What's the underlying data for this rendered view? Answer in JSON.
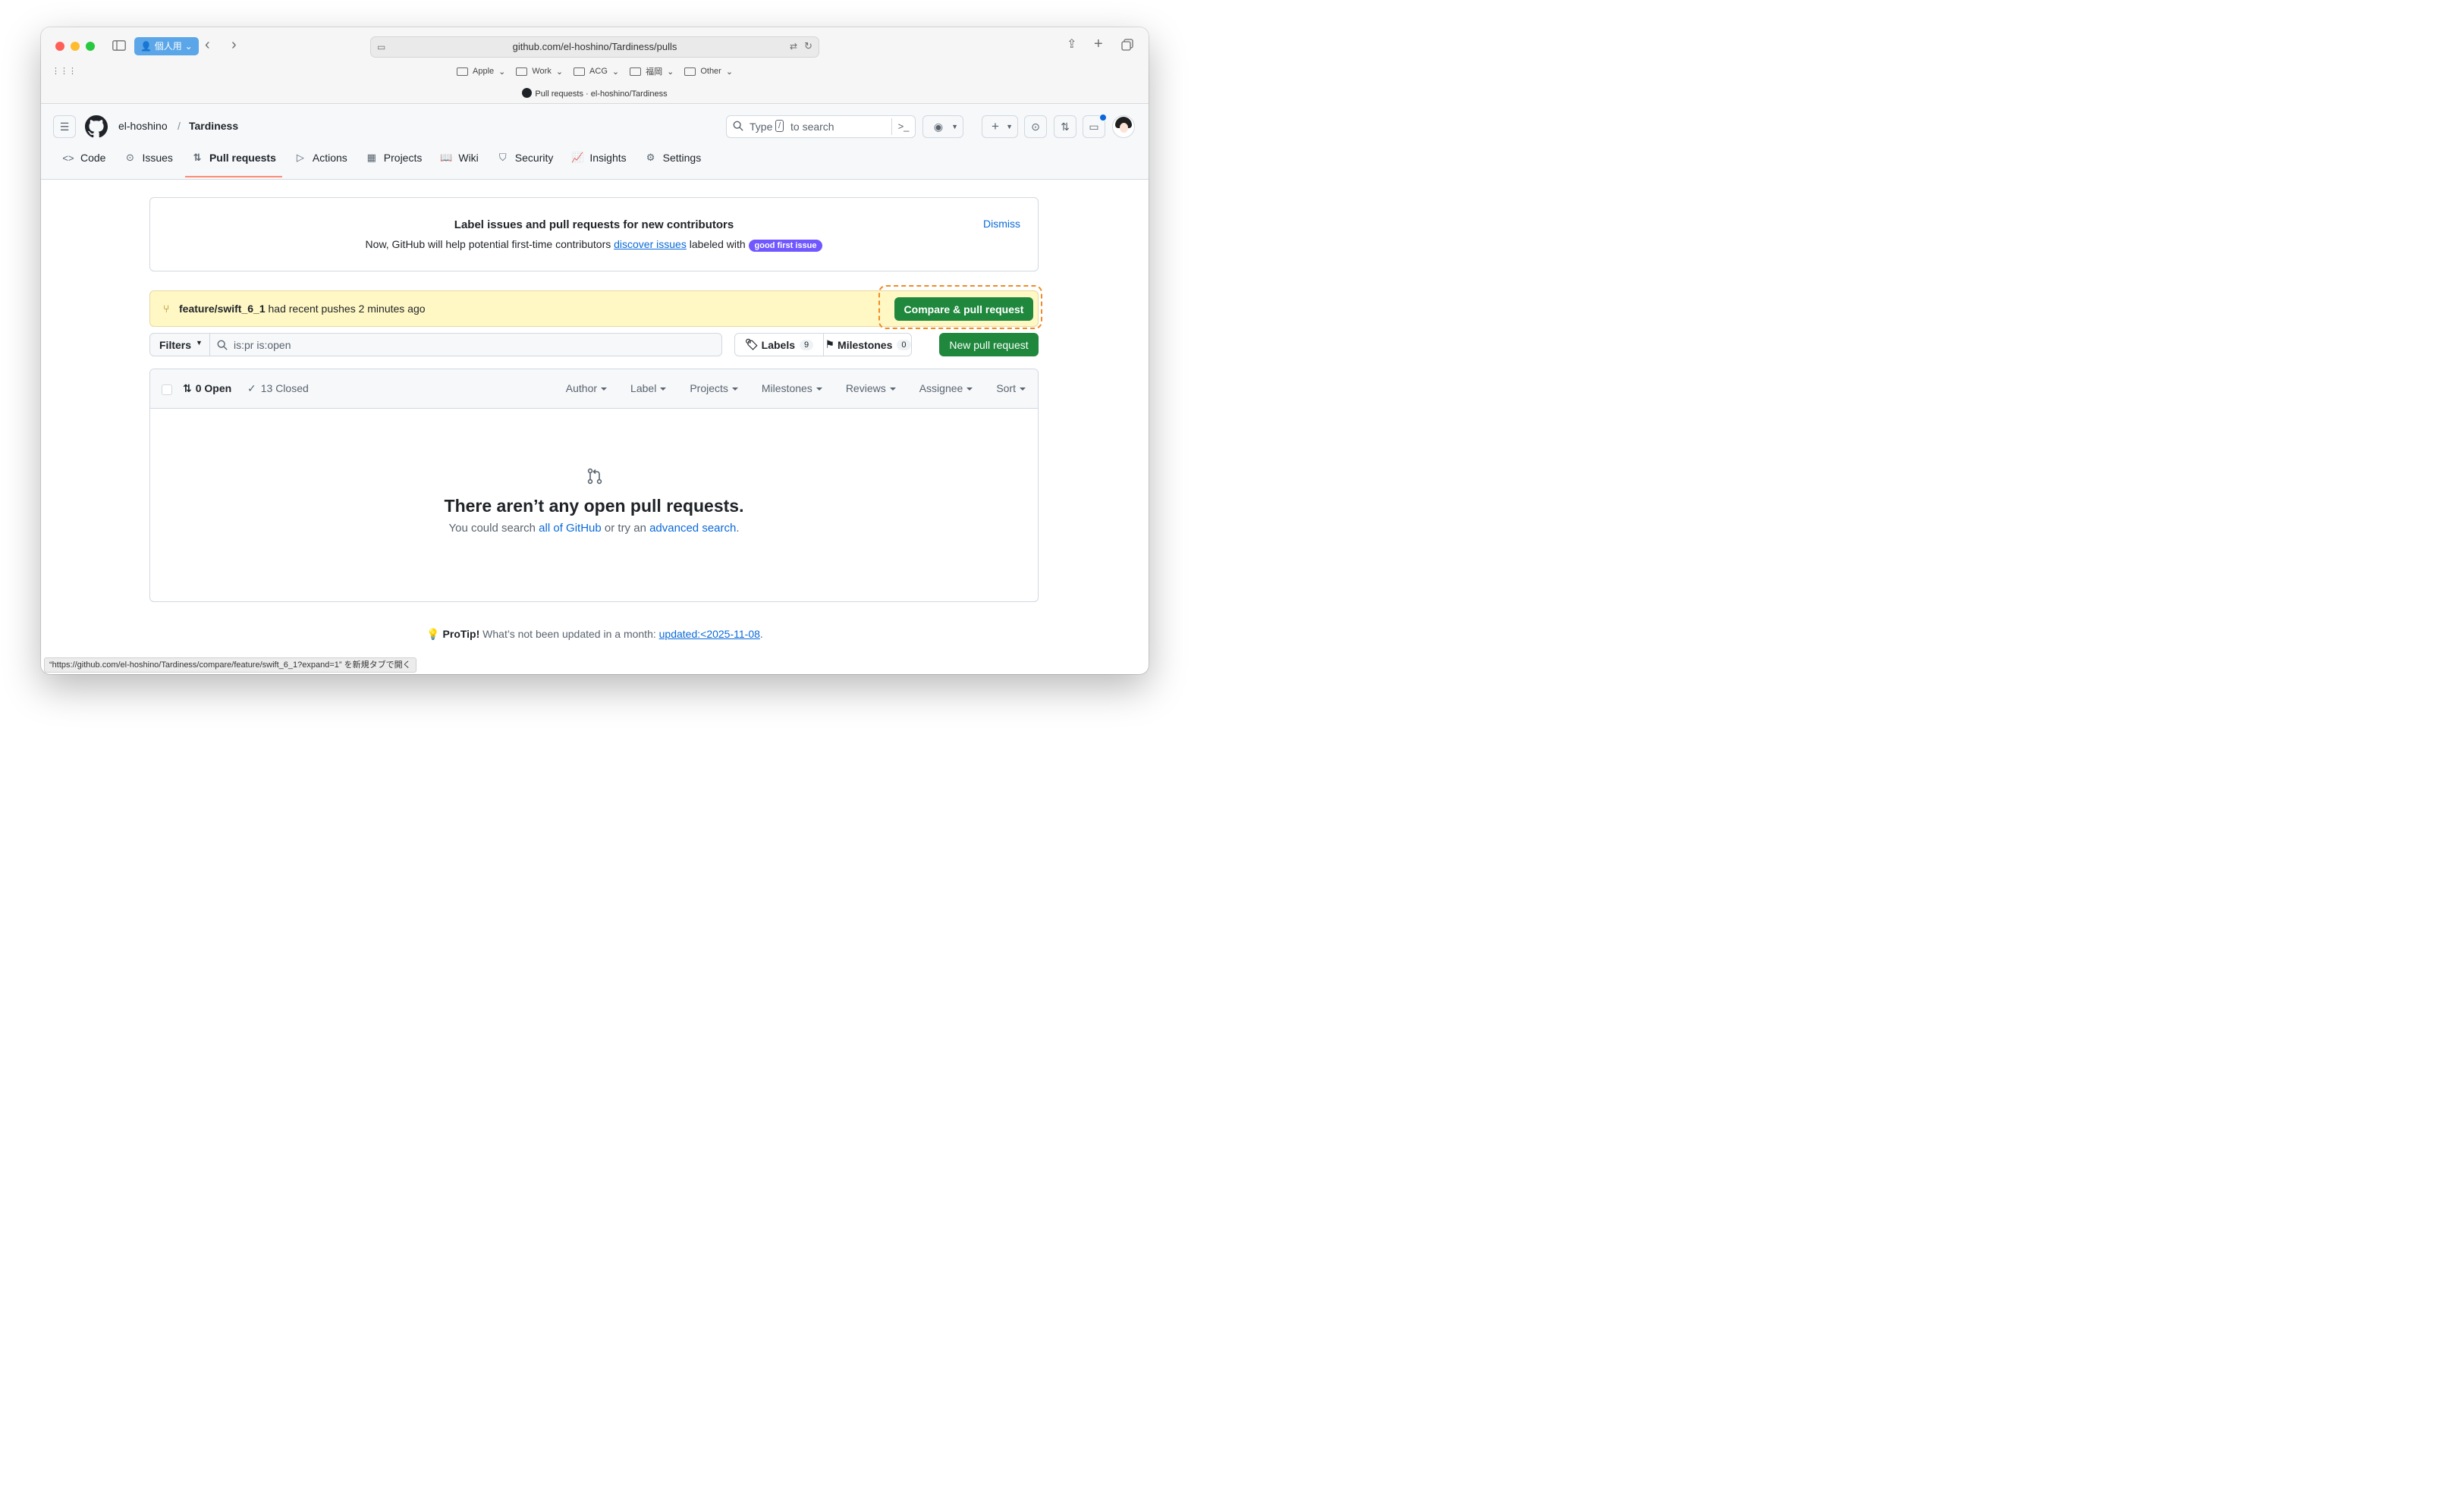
{
  "browser": {
    "profile": "個人用",
    "url": "github.com/el-hoshino/Tardiness/pulls",
    "bookmarks": [
      "Apple",
      "Work",
      "ACG",
      "福岡",
      "Other"
    ],
    "tab_title": "Pull requests · el-hoshino/Tardiness",
    "status_url": "“https://github.com/el-hoshino/Tardiness/compare/feature/swift_6_1?expand=1” を新規タブで開く"
  },
  "header": {
    "owner": "el-hoshino",
    "separator": "/",
    "repo": "Tardiness",
    "search_type": "Type",
    "search_key": "/",
    "search_suffix": "to search"
  },
  "nav": [
    {
      "label": "Code",
      "icon": "code-icon"
    },
    {
      "label": "Issues",
      "icon": "issue-icon"
    },
    {
      "label": "Pull requests",
      "icon": "pull-request-icon"
    },
    {
      "label": "Actions",
      "icon": "play-icon"
    },
    {
      "label": "Projects",
      "icon": "table-icon"
    },
    {
      "label": "Wiki",
      "icon": "book-icon"
    },
    {
      "label": "Security",
      "icon": "shield-icon"
    },
    {
      "label": "Insights",
      "icon": "graph-icon"
    },
    {
      "label": "Settings",
      "icon": "gear-icon"
    }
  ],
  "banner": {
    "title": "Label issues and pull requests for new contributors",
    "desc_pre": "Now, GitHub will help potential first-time contributors",
    "desc_link": "discover issues",
    "desc_post": "labeled with",
    "label": "good first issue",
    "dismiss": "Dismiss"
  },
  "push": {
    "branch": "feature/swift_6_1",
    "message": "had recent pushes 2 minutes ago",
    "button": "Compare & pull request"
  },
  "filters": {
    "button": "Filters",
    "query": "is:pr is:open",
    "labels": "Labels",
    "labels_count": "9",
    "milestones": "Milestones",
    "milestones_count": "0",
    "new_button": "New pull request"
  },
  "list": {
    "open": "0 Open",
    "closed": "13 Closed",
    "facets": [
      "Author",
      "Label",
      "Projects",
      "Milestones",
      "Reviews",
      "Assignee",
      "Sort"
    ]
  },
  "empty": {
    "title": "There aren’t any open pull requests.",
    "pre": "You could search",
    "link1": "all of GitHub",
    "mid": "or try an",
    "link2": "advanced search",
    "end": "."
  },
  "protip": {
    "label": "ProTip!",
    "text": "What’s not been updated in a month:",
    "link": "updated:<2025-11-08",
    "end": "."
  },
  "colors": {
    "accent_green": "#1f883d",
    "link_blue": "#0969da",
    "label_purple": "#7057ff",
    "push_yellow": "#fff8c5",
    "active_tab": "#fd8c73"
  }
}
